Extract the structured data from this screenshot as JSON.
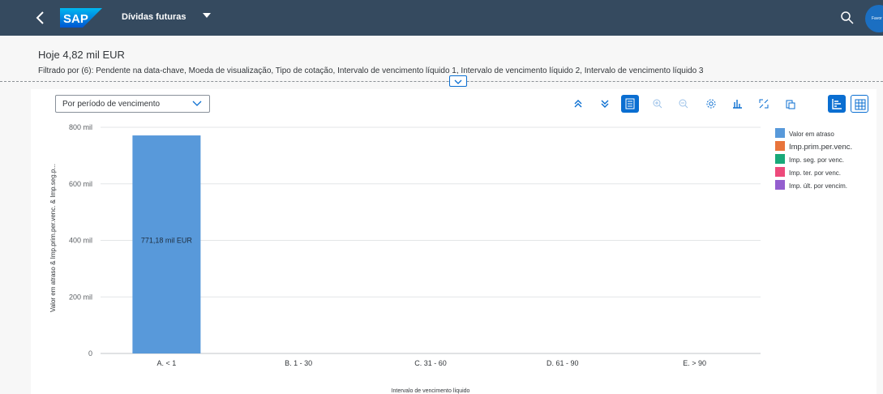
{
  "shell": {
    "back_icon": "chevron-left-icon",
    "logo_text": "SAP",
    "app_title": "Dívidas futuras",
    "search_icon": "search-icon",
    "avatar_text": "Favor"
  },
  "header": {
    "kpi": "Hoje 4,82 mil EUR",
    "filter_text": "Filtrado por (6): Pendente na data-chave, Moeda de visualização, Tipo de cotação, Intervalo de vencimento líquido 1, Intervalo de vencimento líquido 2, Intervalo de vencimento líquido 3"
  },
  "toolbar": {
    "view_select": "Por período de vencimento",
    "buttons": [
      "expand-all-icon",
      "collapse-all-icon",
      "legend-icon",
      "zoom-in-icon",
      "zoom-out-icon",
      "settings-icon",
      "chart-type-icon",
      "fullscreen-icon",
      "copy-icon",
      "chart-view-icon",
      "table-view-icon"
    ]
  },
  "colors": {
    "shell": "#354a5f",
    "accent": "#0a6ed1",
    "series": [
      "#5899da",
      "#e8743b",
      "#19a979",
      "#ed4a7b",
      "#945ecf"
    ]
  },
  "chart_data": {
    "type": "bar",
    "categories": [
      "A. < 1",
      "B. 1 - 30",
      "C. 31 - 60",
      "D. 61 - 90",
      "E. > 90"
    ],
    "series": [
      {
        "name": "Valor em atraso",
        "values": [
          771.18,
          0,
          0,
          0,
          0
        ]
      },
      {
        "name": "Imp.prim.per.venc.",
        "values": [
          0,
          0,
          0,
          0,
          0
        ]
      },
      {
        "name": "Imp. seg. por venc.",
        "values": [
          0,
          0,
          0,
          0,
          0
        ]
      },
      {
        "name": "Imp. ter. por venc.",
        "values": [
          0,
          0,
          0,
          0,
          0
        ]
      },
      {
        "name": "Imp. últ. por vencim.",
        "values": [
          0,
          0,
          0,
          0,
          0
        ]
      }
    ],
    "data_label": "771,18 mil EUR",
    "yticks": [
      "0",
      "200 mil",
      "400 mil",
      "600 mil",
      "800 mil"
    ],
    "ylim": [
      0,
      800
    ],
    "xlabel": "Intervalo de vencimento líquido",
    "ylabel": "Valor em atraso & Imp.prim.per.venc. & Imp.seg.p...",
    "legend_position": "right",
    "grid": true
  }
}
